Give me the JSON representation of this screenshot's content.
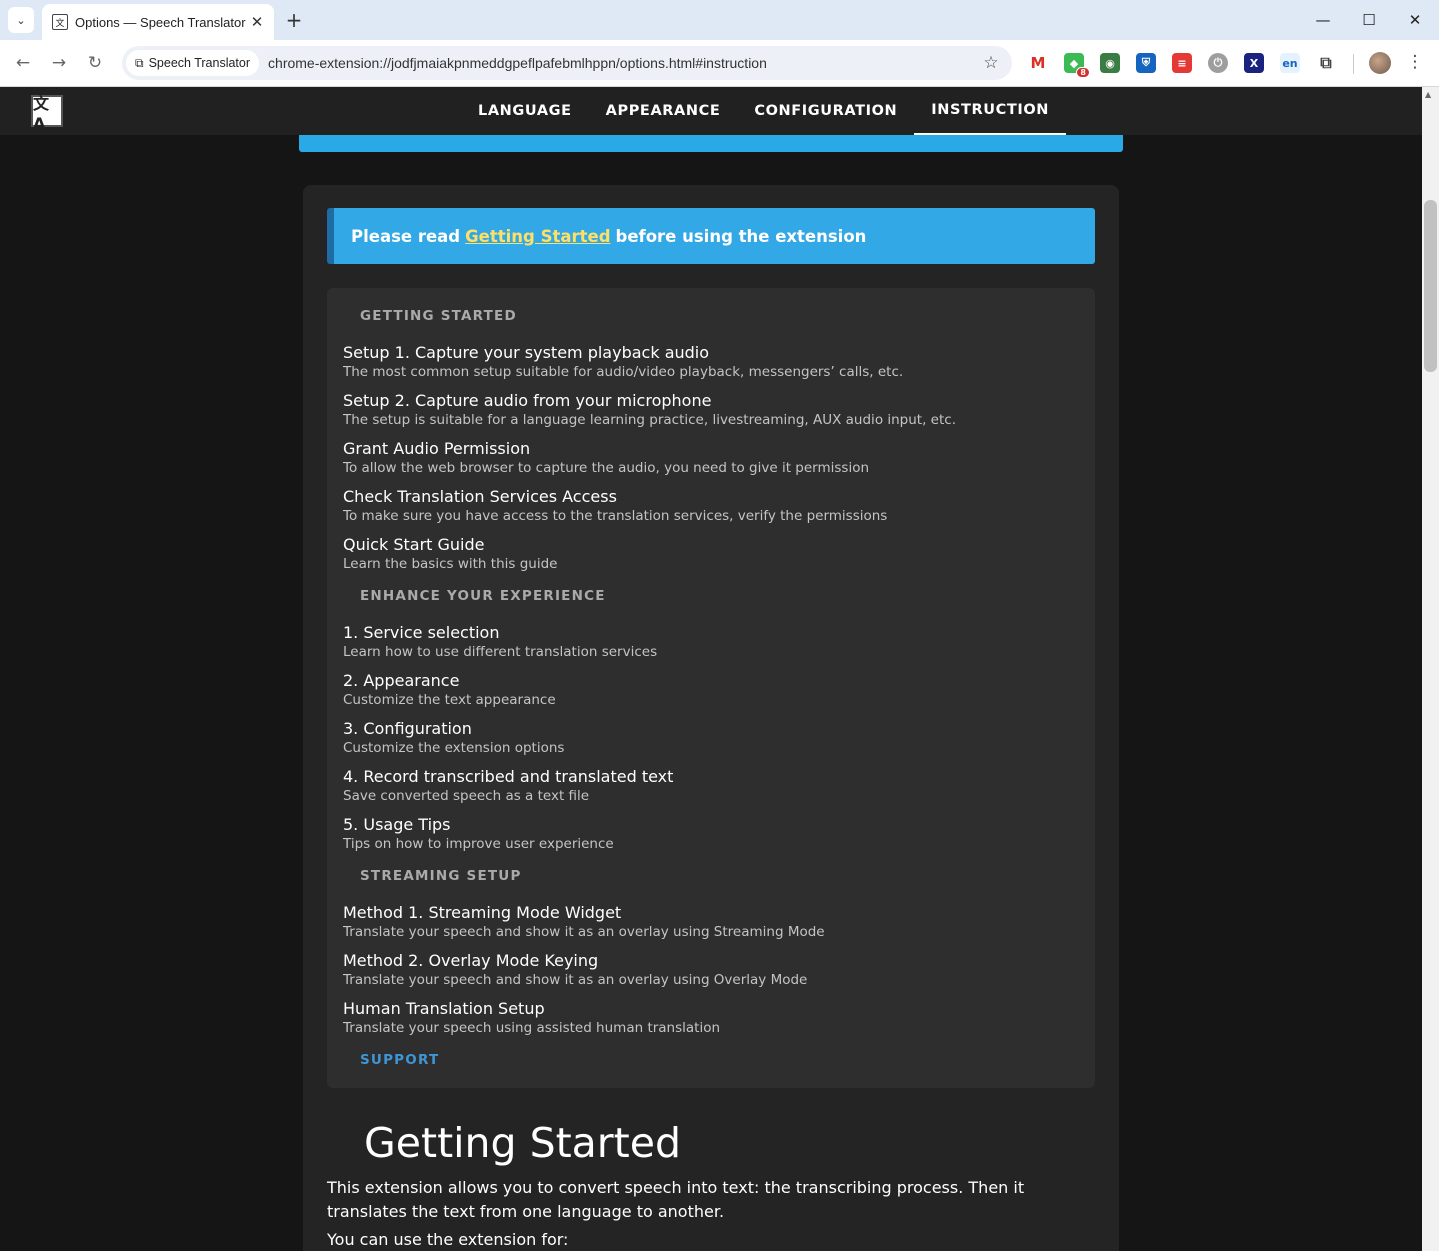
{
  "browser": {
    "tab_title": "Options — Speech Translator",
    "site_chip": "Speech Translator",
    "url": "chrome-extension://jodfjmaiakpnmeddgpeflpafebmlhppn/options.html#instruction",
    "extension_badge": "8",
    "ext_label_en": "en"
  },
  "nav": {
    "tabs": [
      "LANGUAGE",
      "APPEARANCE",
      "CONFIGURATION",
      "INSTRUCTION"
    ],
    "active": "INSTRUCTION"
  },
  "alert": {
    "prefix": "Please read",
    "link": "Getting Started",
    "suffix": "before using the extension"
  },
  "toc": {
    "sections": [
      {
        "header": "GETTING STARTED",
        "items": [
          {
            "title": "Setup 1. Capture your system playback audio",
            "sub": "The most common setup suitable for audio/video playback, messengers’ calls, etc."
          },
          {
            "title": "Setup 2. Capture audio from your microphone",
            "sub": "The setup is suitable for a language learning practice, livestreaming, AUX audio input, etc."
          },
          {
            "title": "Grant Audio Permission",
            "sub": "To allow the web browser to capture the audio, you need to give it permission"
          },
          {
            "title": "Check Translation Services Access",
            "sub": "To make sure you have access to the translation services, verify the permissions"
          },
          {
            "title": "Quick Start Guide",
            "sub": "Learn the basics with this guide"
          }
        ]
      },
      {
        "header": "ENHANCE YOUR EXPERIENCE",
        "items": [
          {
            "title": "1. Service selection",
            "sub": "Learn how to use different translation services"
          },
          {
            "title": "2. Appearance",
            "sub": "Customize the text appearance"
          },
          {
            "title": "3. Configuration",
            "sub": "Customize the extension options"
          },
          {
            "title": "4. Record transcribed and translated text",
            "sub": "Save converted speech as a text file"
          },
          {
            "title": "5. Usage Tips",
            "sub": "Tips on how to improve user experience"
          }
        ]
      },
      {
        "header": "STREAMING SETUP",
        "items": [
          {
            "title": "Method 1. Streaming Mode Widget",
            "sub": "Translate your speech and show it as an overlay using Streaming Mode"
          },
          {
            "title": "Method 2. Overlay Mode Keying",
            "sub": "Translate your speech and show it as an overlay using Overlay Mode"
          },
          {
            "title": "Human Translation Setup",
            "sub": "Translate your speech using assisted human translation"
          }
        ]
      }
    ],
    "support_label": "SUPPORT"
  },
  "content": {
    "heading": "Getting Started",
    "paragraph": "This extension allows you to convert speech into text: the transcribing process. Then it translates the text from one language to another.",
    "paragraph2": "You can use the extension for:"
  },
  "colors": {
    "accent_blue": "#33a8e6",
    "link_yellow": "#ffe066",
    "support_blue": "#3d96d6",
    "page_bg": "#151515",
    "card_bg": "#242424"
  }
}
